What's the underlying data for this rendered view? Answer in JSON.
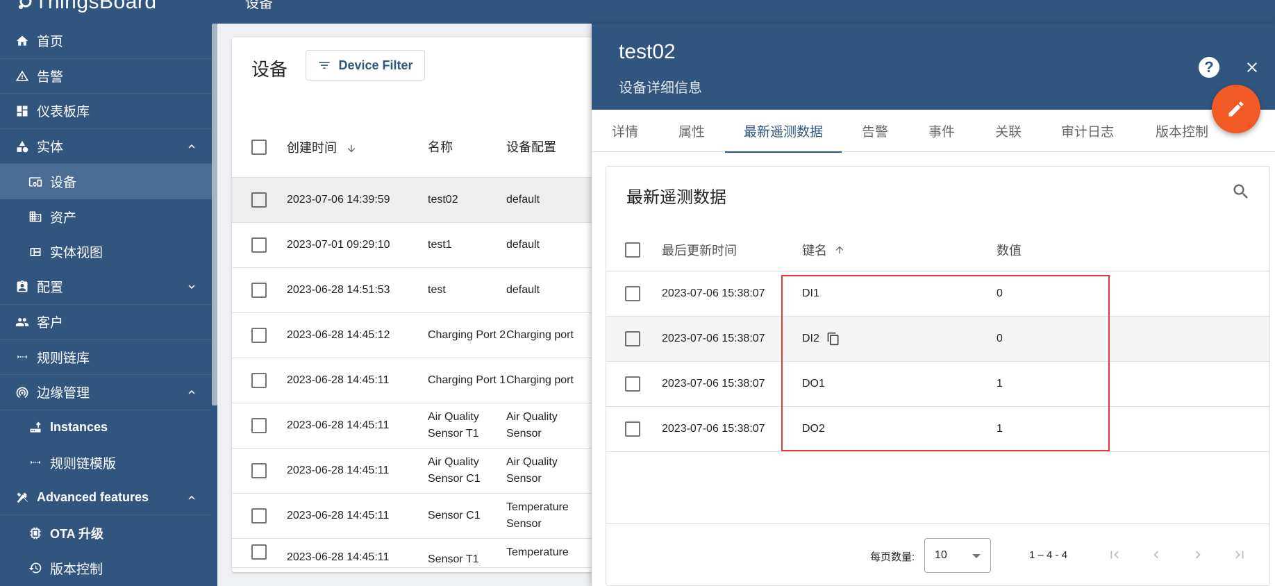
{
  "app": {
    "logo_text": "ThingsBoard",
    "page_title": "设备"
  },
  "sidebar": {
    "items": [
      {
        "label": "首页",
        "icon": "home-icon"
      },
      {
        "label": "告警",
        "icon": "warning-icon"
      },
      {
        "label": "仪表板库",
        "icon": "dashboard-icon"
      },
      {
        "label": "实体",
        "icon": "entity-icon",
        "expanded": true
      },
      {
        "label": "设备",
        "icon": "device-icon",
        "active": true
      },
      {
        "label": "资产",
        "icon": "asset-icon"
      },
      {
        "label": "实体视图",
        "icon": "entity-view-icon"
      },
      {
        "label": "配置",
        "icon": "settings-icon",
        "expanded": false
      },
      {
        "label": "客户",
        "icon": "customers-icon"
      },
      {
        "label": "规则链库",
        "icon": "rule-chain-icon"
      },
      {
        "label": "边缘管理",
        "icon": "edge-icon",
        "expanded": true
      },
      {
        "label": "Instances",
        "icon": "instances-icon"
      },
      {
        "label": "规则链模版",
        "icon": "rule-chain-template-icon"
      },
      {
        "label": "Advanced features",
        "icon": "tools-icon",
        "expanded": true
      },
      {
        "label": "OTA 升级",
        "icon": "ota-icon"
      },
      {
        "label": "版本控制",
        "icon": "history-icon"
      }
    ]
  },
  "devices": {
    "header": "设备",
    "filter_label": "Device Filter",
    "columns": {
      "created": "创建时间",
      "name": "名称",
      "profile": "设备配置"
    },
    "rows": [
      {
        "created": "2023-07-06 14:39:59",
        "name": "test02",
        "profile": "default"
      },
      {
        "created": "2023-07-01 09:29:10",
        "name": "test1",
        "profile": "default"
      },
      {
        "created": "2023-06-28 14:51:53",
        "name": "test",
        "profile": "default"
      },
      {
        "created": "2023-06-28 14:45:12",
        "name": "Charging Port 2",
        "profile": "Charging port"
      },
      {
        "created": "2023-06-28 14:45:11",
        "name": "Charging Port 1",
        "profile": "Charging port"
      },
      {
        "created": "2023-06-28 14:45:11",
        "name": "Air Quality Sensor T1",
        "profile": "Air Quality Sensor"
      },
      {
        "created": "2023-06-28 14:45:11",
        "name": "Air Quality Sensor C1",
        "profile": "Air Quality Sensor"
      },
      {
        "created": "2023-06-28 14:45:11",
        "name": "Sensor C1",
        "profile": "Temperature Sensor"
      },
      {
        "created": "2023-06-28 14:45:11",
        "name": "Sensor T1",
        "profile": "Temperature"
      }
    ]
  },
  "detail": {
    "title": "test02",
    "subtitle": "设备详细信息",
    "help_label": "?",
    "tabs": [
      "详情",
      "属性",
      "最新遥测数据",
      "告警",
      "事件",
      "关联",
      "审计日志",
      "版本控制"
    ],
    "active_tab": "最新遥测数据",
    "telemetry": {
      "title": "最新遥测数据",
      "columns": {
        "updated": "最后更新时间",
        "key": "键名",
        "value": "数值"
      },
      "rows": [
        {
          "updated": "2023-07-06 15:38:07",
          "key": "DI1",
          "value": "0"
        },
        {
          "updated": "2023-07-06 15:38:07",
          "key": "DI2",
          "value": "0"
        },
        {
          "updated": "2023-07-06 15:38:07",
          "key": "DO1",
          "value": "1"
        },
        {
          "updated": "2023-07-06 15:38:07",
          "key": "DO2",
          "value": "1"
        }
      ],
      "pager": {
        "per_page_label": "每页数量:",
        "per_page": "10",
        "range": "1 – 4 - 4"
      }
    }
  },
  "colors": {
    "primary": "#305680",
    "accent": "#f15a24",
    "highlight": "#e53935"
  }
}
